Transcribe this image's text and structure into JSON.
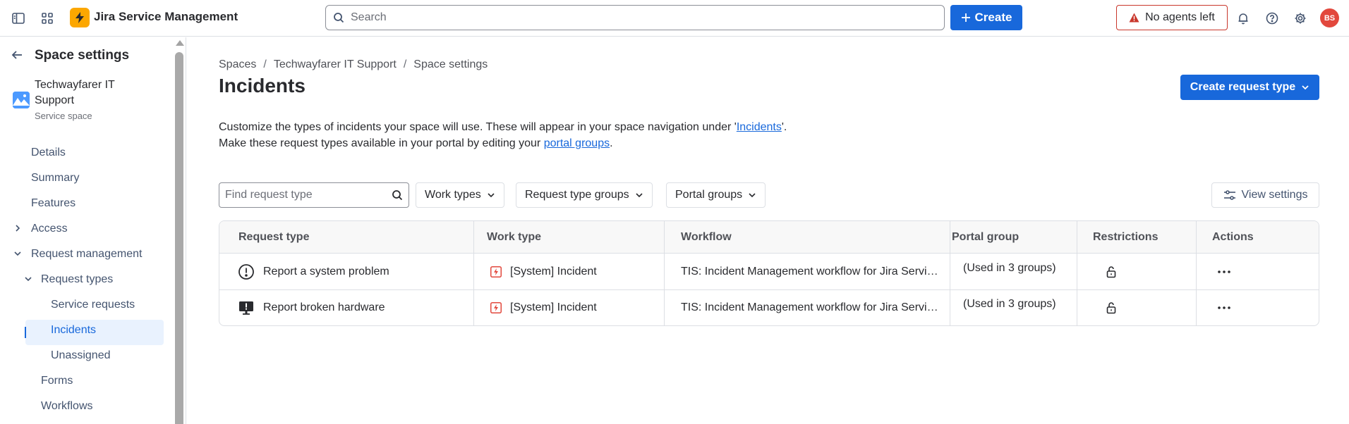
{
  "topbar": {
    "app_name": "Jira Service Management",
    "search_placeholder": "Search",
    "create_label": "Create",
    "no_agents_label": "No agents left",
    "avatar_initials": "BS",
    "brand_color": "#1868db",
    "logo_color": "#fca700"
  },
  "sidebar": {
    "title": "Space settings",
    "space_name": "Techwayfarer IT Support",
    "space_type": "Service space",
    "items": [
      {
        "label": "Details"
      },
      {
        "label": "Summary"
      },
      {
        "label": "Features"
      },
      {
        "label": "Access",
        "expandable": "collapsed"
      },
      {
        "label": "Request management",
        "expandable": "expanded"
      },
      {
        "label": "Request types",
        "expandable": "expanded"
      },
      {
        "label": "Service requests"
      },
      {
        "label": "Incidents",
        "active": true
      },
      {
        "label": "Unassigned"
      },
      {
        "label": "Forms"
      },
      {
        "label": "Workflows"
      }
    ]
  },
  "breadcrumb": [
    "Spaces",
    "Techwayfarer IT Support",
    "Space settings"
  ],
  "page_title": "Incidents",
  "create_request_type_label": "Create request type",
  "description": {
    "line1_before": "Customize the types of incidents your space will use. These will appear in your space navigation under '",
    "line1_link": "Incidents",
    "line1_after": "'.",
    "line2_before": "Make these request types available in your portal by editing your ",
    "line2_link": "portal groups",
    "line2_after": "."
  },
  "filters": {
    "search_placeholder": "Find request type",
    "work_types": "Work types",
    "request_type_groups": "Request type groups",
    "portal_groups": "Portal groups",
    "view_settings": "View settings"
  },
  "table": {
    "headers": [
      "Request type",
      "Work type",
      "Workflow",
      "Portal group",
      "Restrictions",
      "Actions"
    ],
    "rows": [
      {
        "icon": "exclamation-circle-icon",
        "request_type": "Report a system problem",
        "work_type": "[System] Incident",
        "workflow": "TIS: Incident Management workflow for Jira Service Management",
        "portal_group": "(Used in 3 groups)"
      },
      {
        "icon": "monitor-alert-icon",
        "request_type": "Report broken hardware",
        "work_type": "[System] Incident",
        "workflow": "TIS: Incident Management workflow for Jira Service Management",
        "portal_group": "(Used in 3 groups)"
      }
    ]
  }
}
